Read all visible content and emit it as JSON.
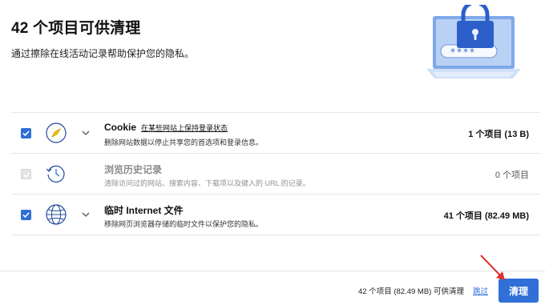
{
  "header": {
    "title": "42 个项目可供清理",
    "subtitle": "通过擦除在线活动记录帮助保护您的隐私。"
  },
  "hero": {
    "password_mask": "****"
  },
  "items": [
    {
      "checked": true,
      "disabled": false,
      "icon": "compass-icon",
      "title": "Cookie",
      "link": "在某些网站上保持登录状态",
      "description": "删除网站数据以停止共享您的首选项和登录信息。",
      "size": "1 个项目 (13 B)"
    },
    {
      "checked": true,
      "disabled": true,
      "icon": "history-icon",
      "title": "浏览历史记录",
      "link": "",
      "description": "清除访问过的网站、搜索内容、下载项以及键入的 URL 的记录。",
      "size": "0 个项目"
    },
    {
      "checked": true,
      "disabled": false,
      "icon": "globe-icon",
      "title": "临时 Internet 文件",
      "link": "",
      "description": "移除网页浏览器存储的临时文件以保护您的隐私。",
      "size": "41 个项目 (82.49 MB)"
    }
  ],
  "footer": {
    "summary": "42 个项目 (82.49 MB) 可供清理",
    "skip_label": "跳过",
    "clean_label": "清理"
  },
  "colors": {
    "accent": "#2f6fd6",
    "annotation_arrow": "#e0322b"
  }
}
